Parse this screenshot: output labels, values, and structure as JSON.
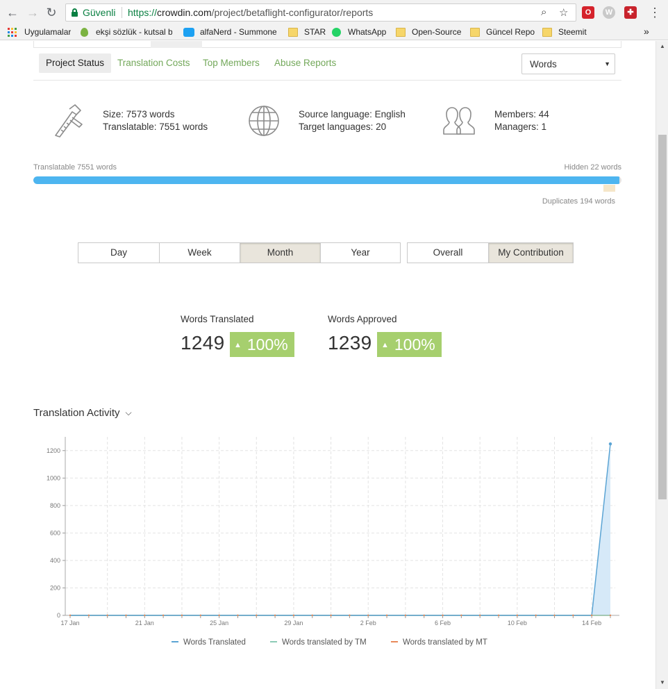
{
  "browser": {
    "secure_label": "Güvenli",
    "url_protocol": "https://",
    "url_host": "crowdin.com",
    "url_path": "/project/betaflight-configurator/reports",
    "icons": [
      "back-icon",
      "forward-icon",
      "reload-icon",
      "lock-icon",
      "zoom-icon",
      "star-icon",
      "menu-icon"
    ]
  },
  "bookmarks": {
    "apps_label": "Uygulamalar",
    "items": [
      "ekşi sözlük - kutsal b",
      "alfaNerd - Summone",
      "STAR",
      "WhatsApp",
      "Open-Source",
      "Güncel Repo",
      "Steemit"
    ],
    "overflow": "»"
  },
  "tabs": {
    "items": [
      "Project Status",
      "Translation Costs",
      "Top Members",
      "Abuse Reports"
    ],
    "active": "Project Status"
  },
  "units_select": {
    "value": "Words"
  },
  "stats": {
    "size": "Size: 7573 words",
    "translatable": "Translatable: 7551 words",
    "source_language": "Source language: English",
    "target_languages": "Target languages: 20",
    "members": "Members: 44",
    "managers": "Managers: 1"
  },
  "progress": {
    "left_label": "Translatable 7551 words",
    "right_label": "Hidden 22 words",
    "below_label": "Duplicates 194 words",
    "translatable_fraction": 0.997
  },
  "period": {
    "options": [
      "Day",
      "Week",
      "Month",
      "Year"
    ],
    "active": "Month"
  },
  "scope": {
    "options": [
      "Overall",
      "My Contribution"
    ],
    "active": "My Contribution"
  },
  "metrics": {
    "translated": {
      "label": "Words Translated",
      "value": "1249",
      "change": "100%"
    },
    "approved": {
      "label": "Words Approved",
      "value": "1239",
      "change": "100%"
    }
  },
  "activity": {
    "title": "Translation Activity"
  },
  "colors": {
    "accent_green": "#73a85a",
    "badge_green": "#a6cf6e",
    "progress_blue": "#4db5f0",
    "series_translated": "#5ba4d4",
    "series_tm": "#8ccbb6",
    "series_mt": "#e8895a"
  },
  "chart_data": {
    "type": "line",
    "title": "Translation Activity",
    "x": [
      "17 Jan",
      "18 Jan",
      "19 Jan",
      "20 Jan",
      "21 Jan",
      "22 Jan",
      "23 Jan",
      "24 Jan",
      "25 Jan",
      "26 Jan",
      "27 Jan",
      "28 Jan",
      "29 Jan",
      "30 Jan",
      "31 Jan",
      "1 Feb",
      "2 Feb",
      "3 Feb",
      "4 Feb",
      "5 Feb",
      "6 Feb",
      "7 Feb",
      "8 Feb",
      "9 Feb",
      "10 Feb",
      "11 Feb",
      "12 Feb",
      "13 Feb",
      "14 Feb",
      "15 Feb"
    ],
    "x_tick_labels": [
      "17 Jan",
      "21 Jan",
      "25 Jan",
      "29 Jan",
      "2 Feb",
      "6 Feb",
      "10 Feb",
      "14 Feb"
    ],
    "y_ticks": [
      0,
      200,
      400,
      600,
      800,
      1000,
      1200
    ],
    "ylim": [
      0,
      1300
    ],
    "grid": true,
    "legend_position": "bottom",
    "series": [
      {
        "name": "Words Translated",
        "values": [
          0,
          0,
          0,
          0,
          0,
          0,
          0,
          0,
          0,
          0,
          0,
          0,
          0,
          0,
          0,
          0,
          0,
          0,
          0,
          0,
          0,
          0,
          0,
          0,
          0,
          0,
          0,
          0,
          0,
          1249
        ]
      },
      {
        "name": "Words translated by TM",
        "values": [
          0,
          0,
          0,
          0,
          0,
          0,
          0,
          0,
          0,
          0,
          0,
          0,
          0,
          0,
          0,
          0,
          0,
          0,
          0,
          0,
          0,
          0,
          0,
          0,
          0,
          0,
          0,
          0,
          0,
          0
        ]
      },
      {
        "name": "Words translated by MT",
        "values": [
          0,
          0,
          0,
          0,
          0,
          0,
          0,
          0,
          0,
          0,
          0,
          0,
          0,
          0,
          0,
          0,
          0,
          0,
          0,
          0,
          0,
          0,
          0,
          0,
          0,
          0,
          0,
          0,
          0,
          0
        ]
      }
    ]
  }
}
